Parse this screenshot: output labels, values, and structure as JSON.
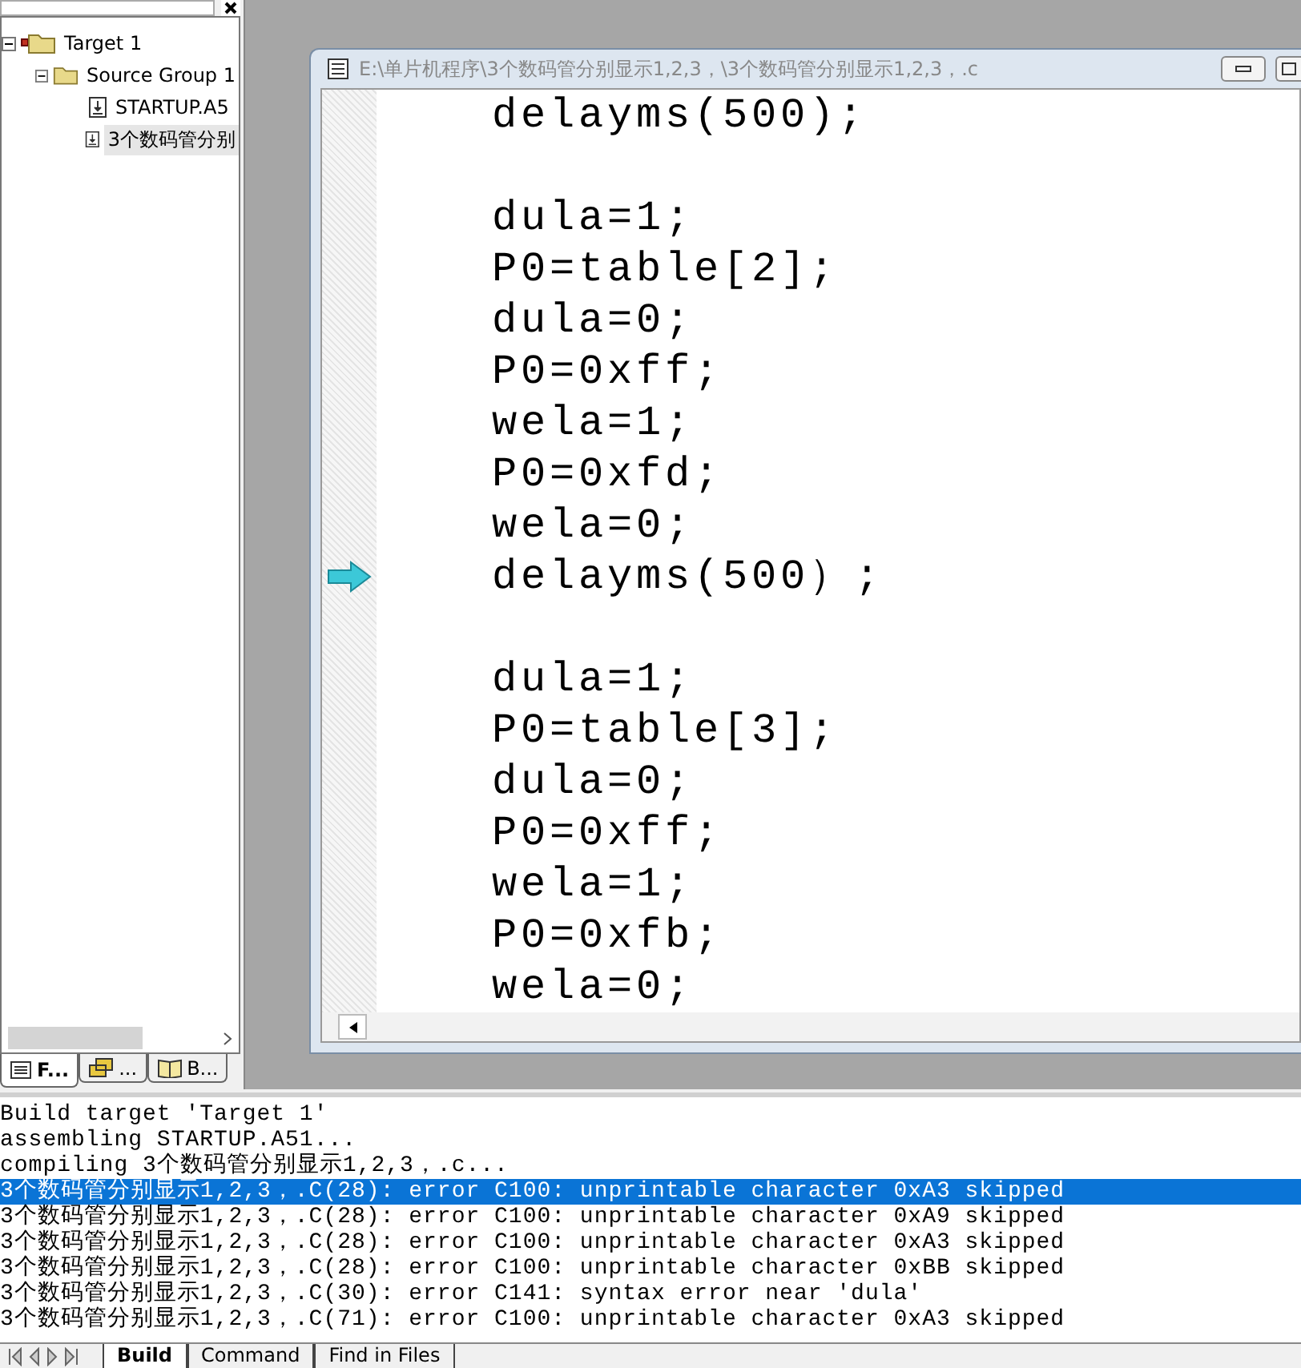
{
  "project_panel": {
    "tree": [
      {
        "label": "Target 1",
        "kind": "target",
        "expanded": true,
        "selected": false,
        "children": [
          {
            "label": "Source Group 1",
            "kind": "group",
            "expanded": true,
            "selected": false,
            "children": [
              {
                "label": "STARTUP.A5",
                "kind": "file",
                "selected": false
              },
              {
                "label": "3个数码管分别",
                "kind": "file",
                "selected": true
              }
            ]
          }
        ]
      }
    ],
    "tabs": [
      {
        "label": "F...",
        "kind": "files",
        "selected": true
      },
      {
        "label": "...",
        "kind": "regs",
        "selected": false
      },
      {
        "label": "B...",
        "kind": "books",
        "selected": false
      }
    ]
  },
  "editor": {
    "title": "E:\\单片机程序\\3个数码管分别显示1,2,3，\\3个数码管分别显示1,2,3，.c",
    "blocks": [
      [
        {
          "text": "delayms(500);",
          "current": false
        }
      ],
      [
        {
          "text": "dula=1;",
          "current": false
        },
        {
          "text": "P0=table[2];",
          "current": false
        },
        {
          "text": "dula=0;",
          "current": false
        },
        {
          "text": "P0=0xff;",
          "current": false
        },
        {
          "text": "wela=1;",
          "current": false
        },
        {
          "text": "P0=0xfd;",
          "current": false
        },
        {
          "text": "wela=0;",
          "current": false
        },
        {
          "text": "delayms(500）;",
          "current": true
        }
      ],
      [
        {
          "text": "dula=1;",
          "current": false
        },
        {
          "text": "P0=table[3];",
          "current": false
        },
        {
          "text": "dula=0;",
          "current": false
        },
        {
          "text": "P0=0xff;",
          "current": false
        },
        {
          "text": "wela=1;",
          "current": false
        },
        {
          "text": "P0=0xfb;",
          "current": false
        },
        {
          "text": "wela=0;",
          "current": false
        }
      ]
    ]
  },
  "output": {
    "lines": [
      {
        "text": "Build target 'Target 1'",
        "selected": false
      },
      {
        "text": "assembling STARTUP.A51...",
        "selected": false
      },
      {
        "text": "compiling 3个数码管分别显示1,2,3，.c...",
        "selected": false
      },
      {
        "text": "3个数码管分别显示1,2,3，.C(28): error C100: unprintable character 0xA3 skipped",
        "selected": true
      },
      {
        "text": "3个数码管分别显示1,2,3，.C(28): error C100: unprintable character 0xA9 skipped",
        "selected": false
      },
      {
        "text": "3个数码管分别显示1,2,3，.C(28): error C100: unprintable character 0xA3 skipped",
        "selected": false
      },
      {
        "text": "3个数码管分别显示1,2,3，.C(28): error C100: unprintable character 0xBB skipped",
        "selected": false
      },
      {
        "text": "3个数码管分别显示1,2,3，.C(30): error C141: syntax error near 'dula'",
        "selected": false
      },
      {
        "text": "3个数码管分别显示1,2,3，.C(71): error C100: unprintable character 0xA3 skipped",
        "selected": false
      }
    ],
    "tabs": [
      {
        "label": "Build",
        "selected": true
      },
      {
        "label": "Command",
        "selected": false
      },
      {
        "label": "Find in Files",
        "selected": false
      }
    ]
  }
}
